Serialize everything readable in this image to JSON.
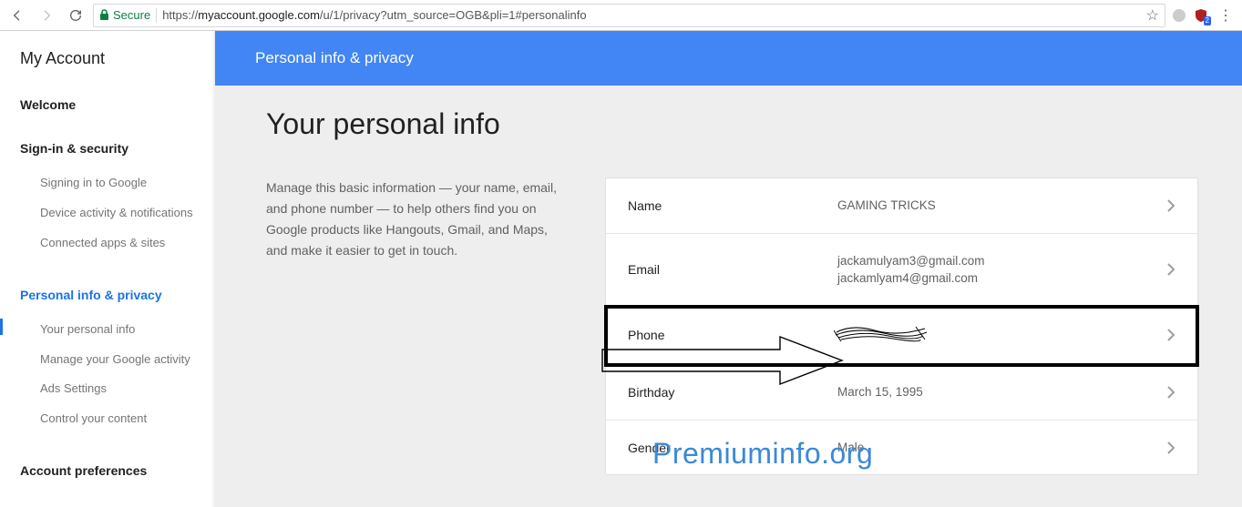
{
  "browser": {
    "secure_label": "Secure",
    "url_prefix": "https://",
    "url_host": "myaccount.google.com",
    "url_path": "/u/1/privacy?utm_source=OGB&pli=1#personalinfo",
    "ext_badge": "2"
  },
  "sidebar": {
    "brand": "My Account",
    "sections": [
      {
        "head": "Welcome",
        "links": []
      },
      {
        "head": "Sign-in & security",
        "links": [
          "Signing in to Google",
          "Device activity & notifications",
          "Connected apps & sites"
        ]
      },
      {
        "head": "Personal info & privacy",
        "active": true,
        "links": [
          "Your personal info",
          "Manage your Google activity",
          "Ads Settings",
          "Control your content"
        ]
      },
      {
        "head": "Account preferences",
        "links": []
      }
    ]
  },
  "hero": {
    "title": "Personal info & privacy"
  },
  "main": {
    "h1": "Your personal info",
    "desc": "Manage this basic information — your name, email, and phone number — to help others find you on Google products like Hangouts, Gmail, and Maps, and make it easier to get in touch."
  },
  "rows": {
    "name": {
      "label": "Name",
      "value": "GAMING TRICKS"
    },
    "email": {
      "label": "Email",
      "value1": "jackamulyam3@gmail.com",
      "value2": "jackamlyam4@gmail.com"
    },
    "phone": {
      "label": "Phone"
    },
    "bday": {
      "label": "Birthday",
      "value": "March 15, 1995"
    },
    "gender": {
      "label": "Gender",
      "value": "Male"
    }
  },
  "watermark": "Premiuminfo.org"
}
